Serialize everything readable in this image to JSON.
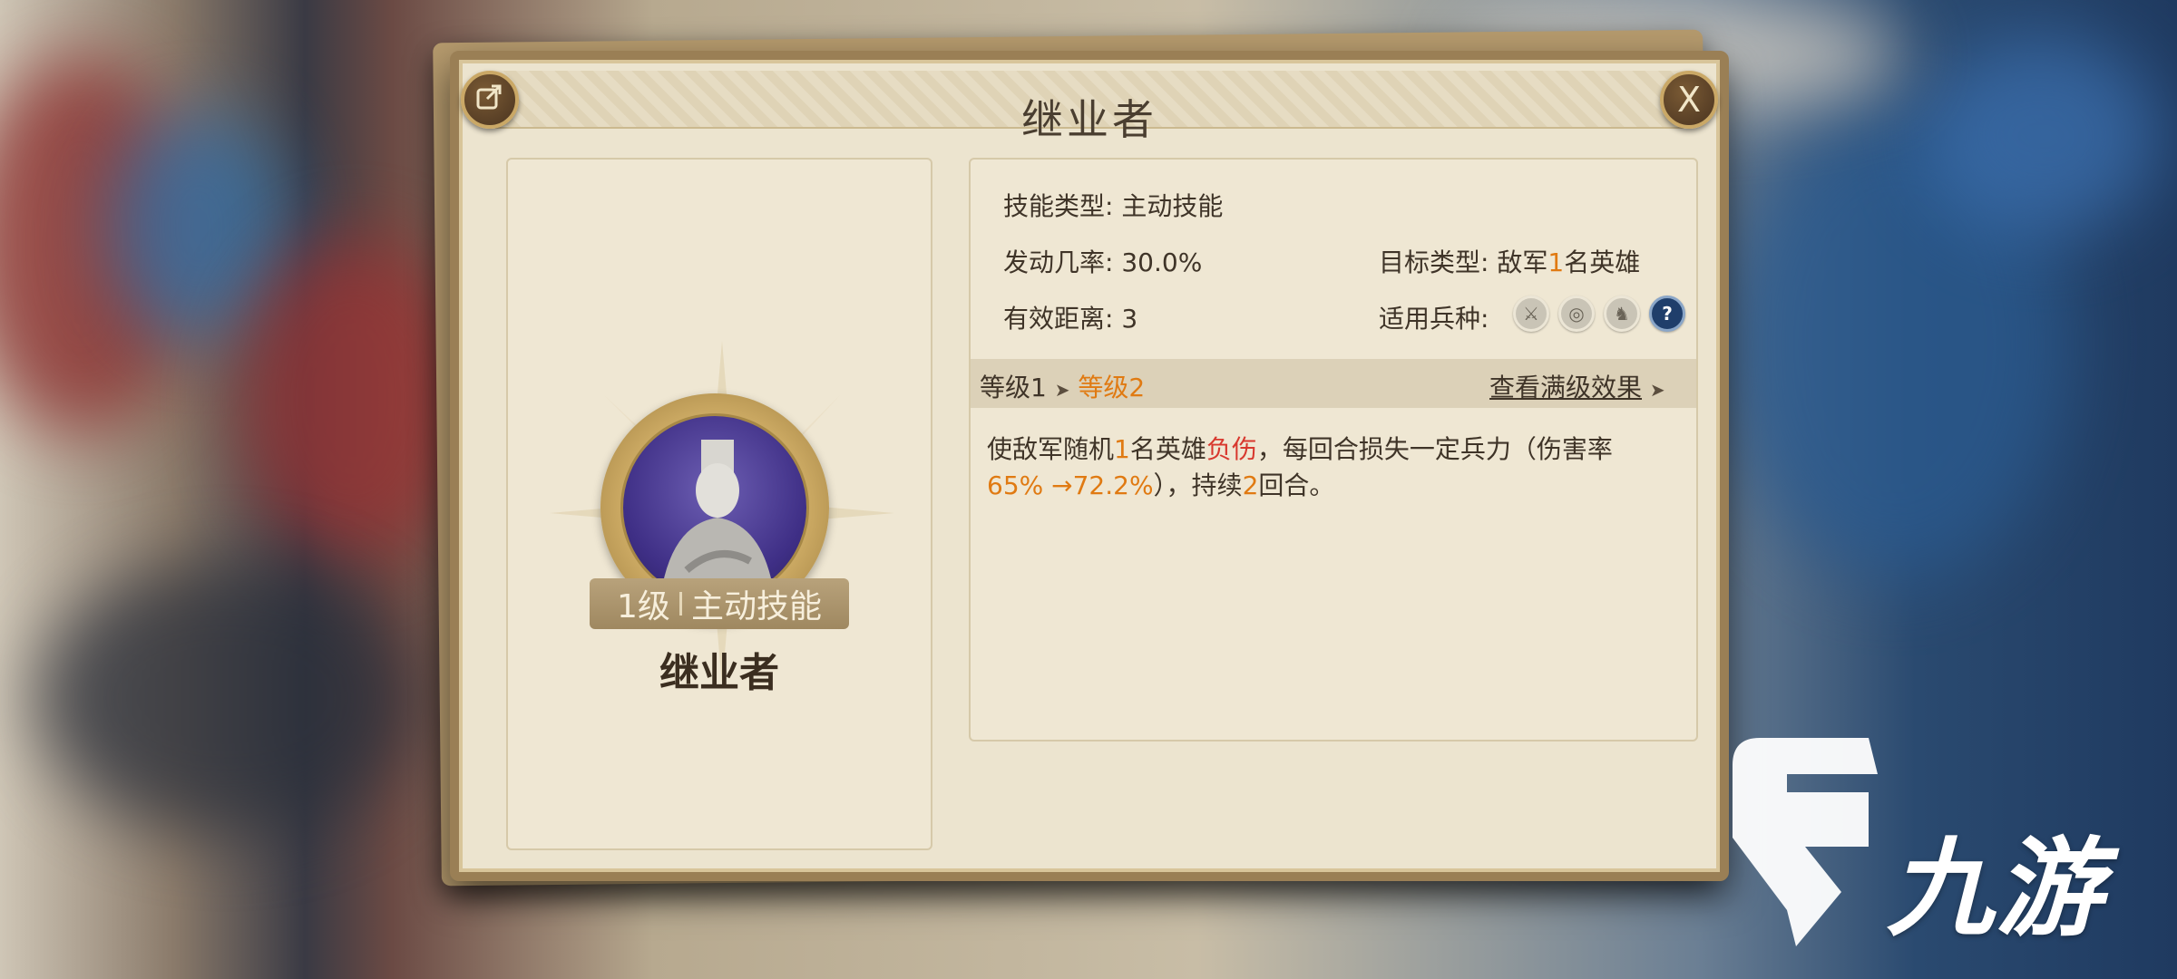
{
  "dialog": {
    "title": "继业者",
    "close_label": "X",
    "share_icon": "share-icon"
  },
  "skill_card": {
    "level_badge_level": "1级",
    "level_badge_type": "主动技能",
    "name": "继业者"
  },
  "details": {
    "skill_type_label": "技能类型:",
    "skill_type_value": "主动技能",
    "trigger_rate_label": "发动几率:",
    "trigger_rate_value": "30.0%",
    "range_label": "有效距离:",
    "range_value": "3",
    "target_type_label": "目标类型:",
    "target_type_prefix": "敌军",
    "target_type_count": "1",
    "target_type_suffix": "名英雄",
    "troop_type_label": "适用兵种:",
    "troop_icons": [
      "sword-icon",
      "target-icon",
      "horse-icon",
      "question-icon"
    ]
  },
  "level_bar": {
    "from_level": "等级1",
    "arrow": "➤",
    "to_level": "等级2",
    "full_effect_link": "查看满级效果",
    "link_arrow": "➤"
  },
  "description": {
    "part1": "使敌军随机",
    "count": "1",
    "part2": "名英雄",
    "status": "负伤",
    "part3": "，每回合损失一定兵力（伤害率",
    "rate": "65% →72.2%",
    "part4": "），持续",
    "turns": "2",
    "part5": "回合。"
  },
  "watermark": {
    "text": "九游"
  },
  "colors": {
    "panel_bg": "#ece4cf",
    "frame": "#9a7f55",
    "highlight_orange": "#e07a12",
    "highlight_red": "#d8382e",
    "text_dark": "#3f3428"
  }
}
